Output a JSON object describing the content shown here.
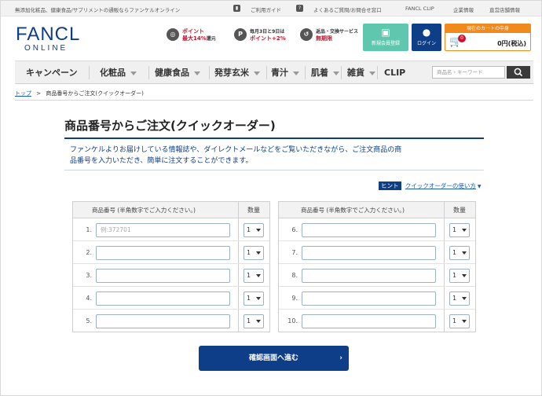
{
  "topbar": {
    "tagline": "無添加化粧品、健康食品/サプリメントの通販ならファンケルオンライン",
    "guide": "ご利用ガイド",
    "faq": "よくあるご質問/お問合せ窓口",
    "clip": "FANCL CLIP",
    "company": "企業情報",
    "stores": "直営店舗情報"
  },
  "logo": {
    "main": "FANCL",
    "sub": "ONLINE"
  },
  "promos": [
    {
      "line1": "ポイント",
      "line2": "最大14%",
      "line3": "還元"
    },
    {
      "line1": "毎月3日と9日は",
      "line2": "ポイント+2%"
    },
    {
      "line1": "返品・交換サービス",
      "line2": "無期限"
    }
  ],
  "header": {
    "register": "新規会員登録",
    "login": "ログイン",
    "cart_title": "現在のカートの中身",
    "cart_count": "0",
    "cart_total": "0円(税込)"
  },
  "nav": [
    "キャンペーン",
    "化粧品",
    "健康食品",
    "発芽玄米",
    "青汁",
    "肌着",
    "雑貨",
    "CLIP"
  ],
  "search": {
    "placeholder": "商品名・キーワード"
  },
  "breadcrumb": {
    "home": "トップ",
    "sep": ">",
    "current": "商品番号からご注文(クイックオーダー)"
  },
  "page": {
    "title": "商品番号からご注文(クイックオーダー)",
    "desc1": "ファンケルよりお届けしている情報誌や、ダイレクトメールなどをご覧いただきながら、ご注文商品の商",
    "desc2": "品番号を入力いただき、簡単に注文することができます。",
    "hint_label": "ヒント",
    "hint_link": "クイックオーダーの使い方"
  },
  "table": {
    "col_code": "商品番号 (半角数字でご入力ください。)",
    "col_qty": "数量",
    "placeholder_first": "例:372701",
    "left_rows": [
      "1.",
      "2.",
      "3.",
      "4.",
      "5."
    ],
    "right_rows": [
      "6.",
      "7.",
      "8.",
      "9.",
      "10."
    ],
    "qty_default": "1"
  },
  "submit": {
    "label": "確認画面へ進む",
    "arrow": "›"
  },
  "colors": {
    "brand": "#0e3e87",
    "accent": "#f08a1e",
    "register": "#5fc7ad"
  }
}
